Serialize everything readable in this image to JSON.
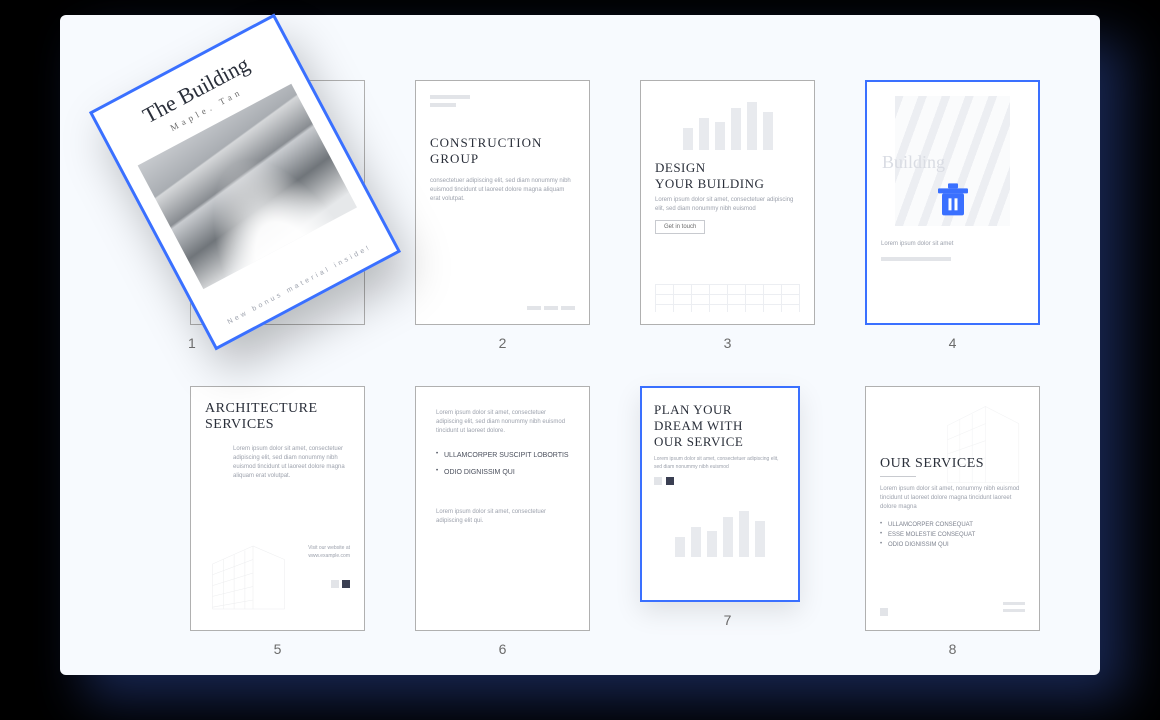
{
  "accent": "#3A70FF",
  "dragged": {
    "index": 1,
    "title": "The Building",
    "subtitle": "Maple. Tan",
    "footer": "New bonus material inside!"
  },
  "pages": [
    {
      "n": 1
    },
    {
      "n": 2,
      "title": "CONSTRUCTION",
      "subtitle": "GROUP",
      "body": "consectetuer adipiscing elit, sed diam nonummy nibh euismod tincidunt ut laoreet dolore magna aliquam erat volutpat."
    },
    {
      "n": 3,
      "title1": "DESIGN",
      "title2": "YOUR BUILDING",
      "body": "Lorem ipsum dolor sit amet, consectetuer adipiscing elit, sed diam nonummy nibh euismod",
      "button": "Get in touch"
    },
    {
      "n": 4,
      "title": "Building",
      "body": "Lorem ipsum dolor sit amet",
      "icon": "trash-icon"
    },
    {
      "n": 5,
      "title1": "ARCHITECTURE",
      "title2": "SERVICES",
      "body": "Lorem ipsum dolor sit amet, consectetuer adipiscing elit, sed diam nonummy nibh euismod tincidunt ut laoreet dolore magna aliquam erat volutpat.",
      "link1": "Visit our website at",
      "link2": "www.example.com"
    },
    {
      "n": 6,
      "intro": "Lorem ipsum dolor sit amet, consectetuer adipiscing elit, sed diam nonummy nibh euismod tincidunt ut laoreet dolore.",
      "bullets": [
        "ULLAMCORPER SUSCIPIT LOBORTIS",
        "ODIO DIGNISSIM QUI"
      ],
      "outro": "Lorem ipsum dolor sit amet, consectetuer adipiscing elit qui."
    },
    {
      "n": 7,
      "title1": "PLAN YOUR",
      "title2": "DREAM WITH",
      "title3": "OUR SERVICE",
      "body": "Lorem ipsum dolor sit amet, consectetuer adipiscing elit, sed diam nonummy nibh euismod"
    },
    {
      "n": 8,
      "title": "OUR SERVICES",
      "body": "Lorem ipsum dolor sit amet, nonummy nibh euismod tincidunt ut laoreet dolore magna tincidunt laoreet dolore magna",
      "bullets": [
        "ULLAMCORPER CONSEQUAT",
        "ESSE MOLESTIE CONSEQUAT",
        "ODIO DIGNISSIM QUI"
      ]
    }
  ]
}
